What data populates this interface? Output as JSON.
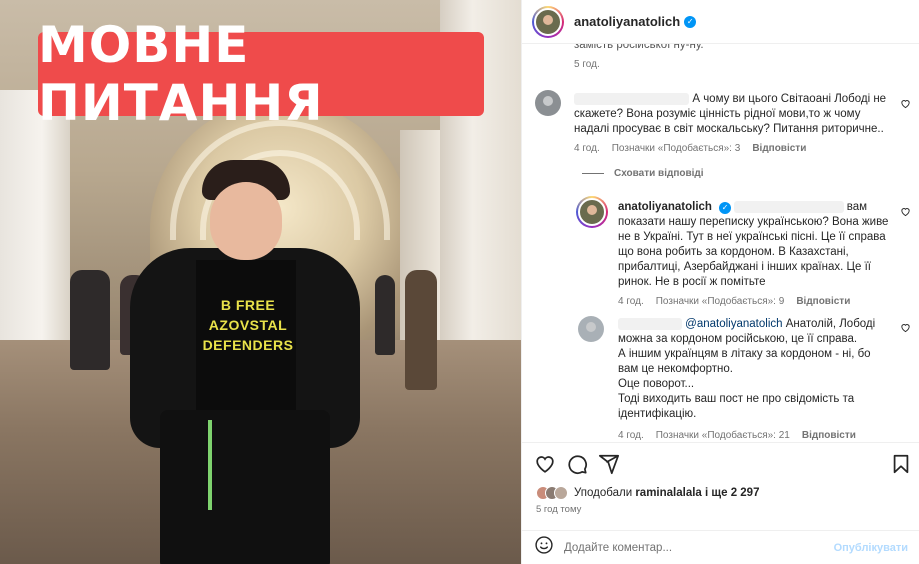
{
  "post": {
    "banner_text": "МОВНЕ ПИТАННЯ",
    "shirt_text": [
      "B FREE",
      "AZOVSTAL",
      "DEFENDERS"
    ]
  },
  "header": {
    "username": "anatoliyanatolich",
    "verified": true
  },
  "comments": [
    {
      "id": "c0",
      "text_partial": "замість російської ну-ну.",
      "time": "5 год."
    },
    {
      "id": "c1",
      "text": "А чому ви цього Світаоані Лободі не скажете? Вона розуміє цінність рідної мови,то ж чому надалі просуває в світ москальську? Питання риторичне..",
      "time": "4 год.",
      "likes": "Позначки «Подобається»: 3",
      "reply": "Відповісти"
    }
  ],
  "hide_replies": "Сховати відповіді",
  "replies": [
    {
      "id": "r1",
      "username": "anatoliyanatolich",
      "verified": true,
      "text_after": "вам показати нашу переписку українською? Вона живе не в Україні. Тут в неї українські пісні. Це її справа що вона робить за кордоном. В Казахстані, прибалтиці, Азербайджані і інших країнах. Це її ринок. Не в росії ж помітьте",
      "time": "4 год.",
      "likes": "Позначки «Подобається»: 9",
      "reply": "Відповісти"
    },
    {
      "id": "r2",
      "mention": "@anatoliyanatolich",
      "lines": [
        "Анатолій, Лободі можна за кордоном російською, це її справа.",
        "А іншим українцям в літаку за кордоном - ні, бо вам це некомфортно.",
        "Оце поворот...",
        "Тоді виходить ваш пост не про свідомість та ідентифікацію."
      ],
      "time": "4 год.",
      "likes": "Позначки «Подобається»: 21",
      "reply": "Відповісти"
    }
  ],
  "likes_summary": {
    "prefix": "Уподобали",
    "user": "raminalalala",
    "suffix": "і ще 2 297"
  },
  "post_time": "5 год тому",
  "add_comment": {
    "placeholder": "Додайте коментар...",
    "publish": "Опублікувати"
  },
  "icons": [
    "heart-icon",
    "comment-icon",
    "share-icon",
    "bookmark-icon",
    "emoji-icon"
  ],
  "colors": {
    "banner": "#ef4b4b",
    "link": "#00376b",
    "verified": "#0095f6",
    "publish_disabled": "#b3dbff"
  }
}
